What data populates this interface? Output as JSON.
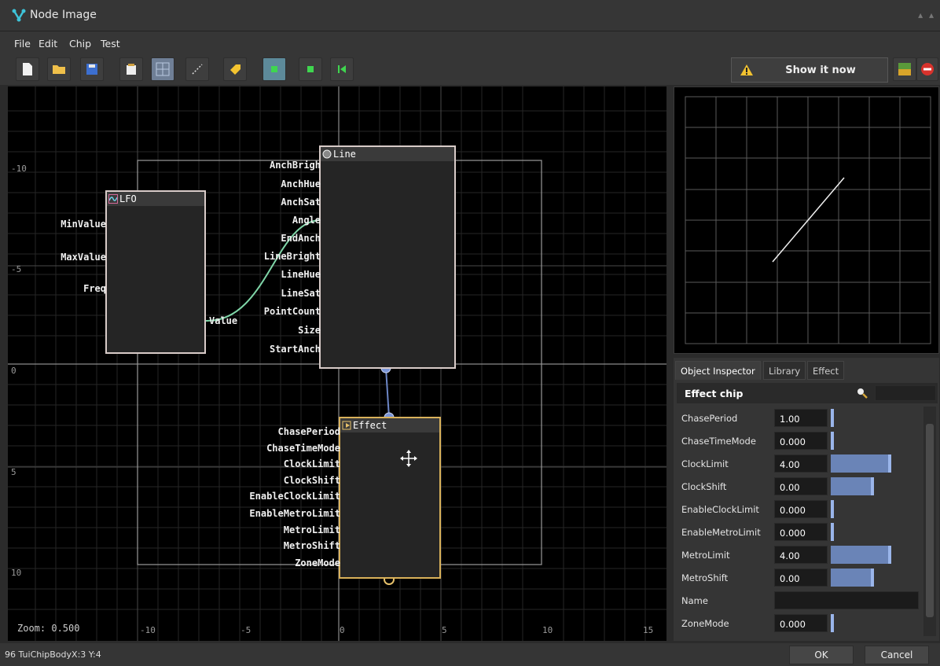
{
  "window": {
    "title": "Node Image"
  },
  "menu": [
    "File",
    "Edit",
    "Chip",
    "Test"
  ],
  "toolbar": {
    "show_now": "Show it now"
  },
  "canvas": {
    "zoom_label": "Zoom: 0.500",
    "y_ticks": [
      "-10",
      "-5",
      "0",
      "5",
      "10"
    ],
    "x_ticks": [
      "-10",
      "-5",
      "0",
      "5",
      "10",
      "15"
    ],
    "nodes": {
      "lfo": {
        "title": "LFO",
        "inputs": [
          "MinValue",
          "MaxValue",
          "Freq"
        ],
        "outputs": [
          "Value"
        ]
      },
      "line": {
        "title": "Line",
        "inputs": [
          "AnchBrigh",
          "AnchHue",
          "AnchSat",
          "Angle",
          "EndAnch",
          "LineBright",
          "LineHue",
          "LineSat",
          "PointCount",
          "Size",
          "StartAnch"
        ]
      },
      "effect": {
        "title": "Effect",
        "inputs": [
          "ChasePeriod",
          "ChaseTimeMode",
          "ClockLimit",
          "ClockShift",
          "EnableClockLimit",
          "EnableMetroLimit",
          "MetroLimit",
          "MetroShift",
          "ZoneMode"
        ]
      }
    }
  },
  "inspector": {
    "tabs": [
      "Object Inspector",
      "Library",
      "Effect"
    ],
    "header": "Effect chip",
    "rows": [
      {
        "name": "ChasePeriod",
        "value": "1.00",
        "fill": 0.0
      },
      {
        "name": "ChaseTimeMode",
        "value": "0.000",
        "fill": 0.0
      },
      {
        "name": "ClockLimit",
        "value": "4.00",
        "fill": 0.7
      },
      {
        "name": "ClockShift",
        "value": "0.00",
        "fill": 0.5
      },
      {
        "name": "EnableClockLimit",
        "value": "0.000",
        "fill": 0.0
      },
      {
        "name": "EnableMetroLimit",
        "value": "0.000",
        "fill": 0.0
      },
      {
        "name": "MetroLimit",
        "value": "4.00",
        "fill": 0.7
      },
      {
        "name": "MetroShift",
        "value": "0.00",
        "fill": 0.5
      },
      {
        "name": "Name",
        "value": ""
      },
      {
        "name": "ZoneMode",
        "value": "0.000",
        "fill": 0.0
      }
    ]
  },
  "status": {
    "text": "96 TuiChipBodyX:3 Y:4",
    "ok": "OK",
    "cancel": "Cancel"
  },
  "colors": {
    "wire_green": "#7fd6a8",
    "wire_blue": "#6c86c6",
    "effect_border": "#d9b15a",
    "value_bar": "#6a84b7"
  },
  "icons": [
    "new-file-icon",
    "open-folder-icon",
    "save-icon",
    "export-icon",
    "grid-icon",
    "wand-icon",
    "tag-icon",
    "play-icon",
    "stop-icon",
    "rewind-icon",
    "warning-icon",
    "palette-icon",
    "stop-sign-icon",
    "search-icon",
    "move-cursor-icon"
  ]
}
